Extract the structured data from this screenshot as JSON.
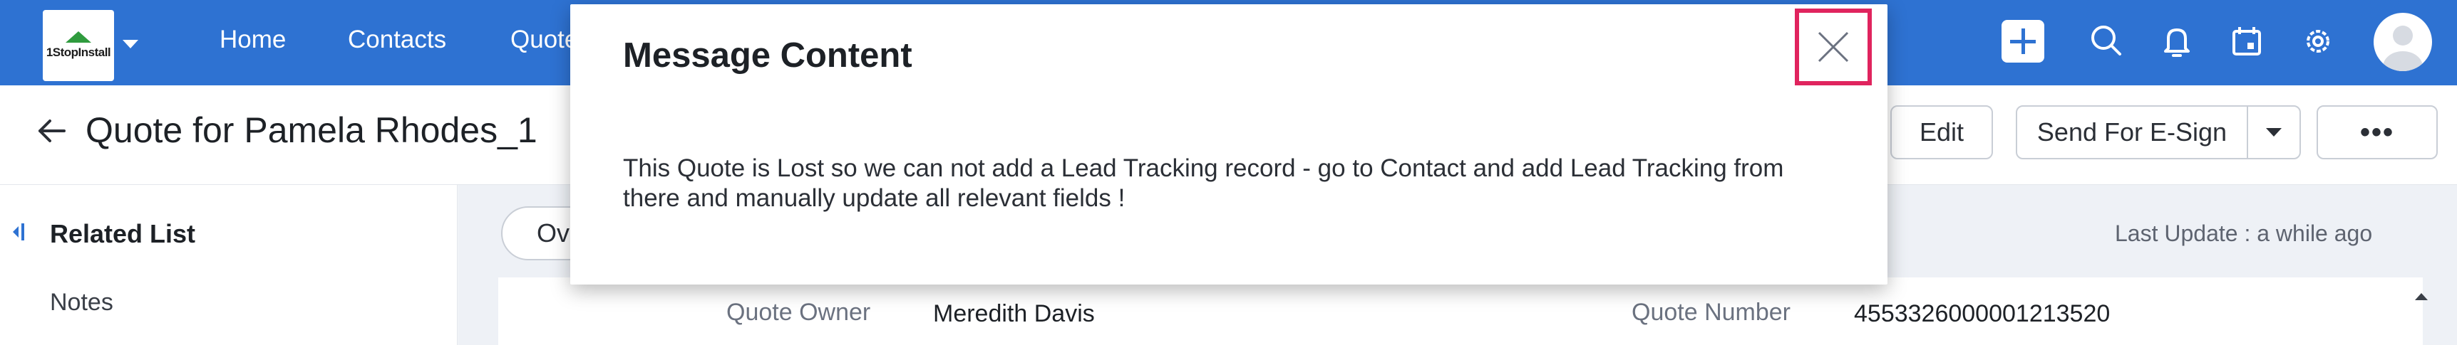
{
  "topnav": {
    "logo_text": "1StopInstall",
    "tabs": [
      "Home",
      "Contacts",
      "Quotes"
    ],
    "icons": [
      "add-icon",
      "search-icon",
      "bell-icon",
      "calendar-icon",
      "gear-icon",
      "avatar"
    ]
  },
  "record": {
    "title": "Quote for Pamela Rhodes_1",
    "buttons": {
      "edit": "Edit",
      "send_esign": "Send For E-Sign",
      "more": "•••"
    }
  },
  "sidebar": {
    "title": "Related List",
    "items": [
      "Notes"
    ]
  },
  "main": {
    "pill_label": "Ov",
    "last_update": "Last Update : a while ago",
    "fields": [
      {
        "label": "Quote Owner",
        "value": "Meredith Davis"
      },
      {
        "label": "Quote Number",
        "value": "4553326000001213520"
      }
    ]
  },
  "modal": {
    "title": "Message Content",
    "body_line1": "This Quote is Lost so we can not add a Lead Tracking record - go to Contact and add Lead Tracking from",
    "body_line2": "there and manually update all relevant fields !"
  },
  "colors": {
    "nav_blue": "#2e72d2",
    "close_highlight": "#e0245e",
    "logo_green": "#2f9b3e"
  }
}
